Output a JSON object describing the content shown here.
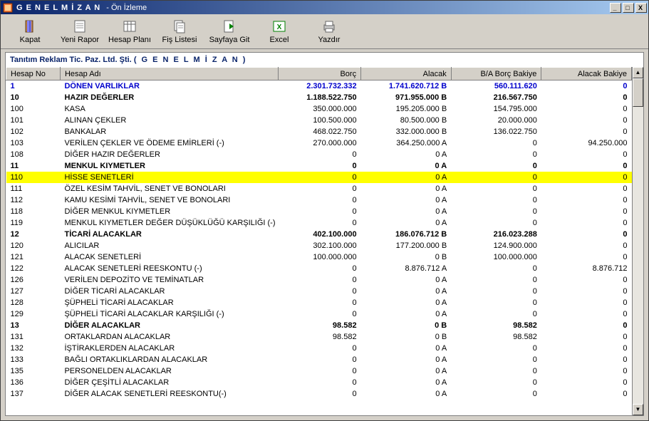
{
  "window": {
    "title_main": "G E N E L   M İ Z A N",
    "title_sub": "- Ön İzleme"
  },
  "toolbar": {
    "kapat": "Kapat",
    "yeni_rapor": "Yeni Rapor",
    "hesap_plani": "Hesap Planı",
    "fis_listesi": "Fiş Listesi",
    "sayfaya_git": "Sayfaya Git",
    "excel": "Excel",
    "yazdir": "Yazdır"
  },
  "header": {
    "company": "Tanıtım Reklam Tic. Paz. Ltd. Şti.",
    "report": "( G E N E L   M İ Z A N )"
  },
  "columns": {
    "hesap_no": "Hesap No",
    "hesap_adi": "Hesap Adı",
    "borc": "Borç",
    "alacak": "Alacak",
    "ba_borc_bakiye": "B/A Borç Bakiye",
    "alacak_bakiye": "Alacak Bakiye"
  },
  "rows": [
    {
      "no": "1",
      "ad": "DÖNEN VARLIKLAR",
      "borc": "2.301.732.332",
      "alacak": "1.741.620.712 B",
      "bakiye": "560.111.620",
      "alb": "0",
      "style": "blue"
    },
    {
      "no": "10",
      "ad": "HAZIR DEĞERLER",
      "borc": "1.188.522.750",
      "alacak": "971.955.000 B",
      "bakiye": "216.567.750",
      "alb": "0",
      "style": "bold"
    },
    {
      "no": "100",
      "ad": "KASA",
      "borc": "350.000.000",
      "alacak": "195.205.000 B",
      "bakiye": "154.795.000",
      "alb": "0",
      "style": ""
    },
    {
      "no": "101",
      "ad": "ALINAN ÇEKLER",
      "borc": "100.500.000",
      "alacak": "80.500.000 B",
      "bakiye": "20.000.000",
      "alb": "0",
      "style": ""
    },
    {
      "no": "102",
      "ad": "BANKALAR",
      "borc": "468.022.750",
      "alacak": "332.000.000 B",
      "bakiye": "136.022.750",
      "alb": "0",
      "style": ""
    },
    {
      "no": "103",
      "ad": "VERİLEN ÇEKLER VE ÖDEME EMİRLERİ (-)",
      "borc": "270.000.000",
      "alacak": "364.250.000 A",
      "bakiye": "0",
      "alb": "94.250.000",
      "style": ""
    },
    {
      "no": "108",
      "ad": "DİĞER HAZIR DEĞERLER",
      "borc": "0",
      "alacak": "0 A",
      "bakiye": "0",
      "alb": "0",
      "style": ""
    },
    {
      "no": "11",
      "ad": "MENKUL KIYMETLER",
      "borc": "0",
      "alacak": "0 A",
      "bakiye": "0",
      "alb": "0",
      "style": "bold"
    },
    {
      "no": "110",
      "ad": "HİSSE SENETLERİ",
      "borc": "0",
      "alacak": "0 A",
      "bakiye": "0",
      "alb": "0",
      "style": "sel"
    },
    {
      "no": "111",
      "ad": "ÖZEL KESİM TAHVİL, SENET VE BONOLARI",
      "borc": "0",
      "alacak": "0 A",
      "bakiye": "0",
      "alb": "0",
      "style": ""
    },
    {
      "no": "112",
      "ad": "KAMU KESİMİ TAHVİL, SENET VE BONOLARI",
      "borc": "0",
      "alacak": "0 A",
      "bakiye": "0",
      "alb": "0",
      "style": ""
    },
    {
      "no": "118",
      "ad": "DİĞER MENKUL KIYMETLER",
      "borc": "0",
      "alacak": "0 A",
      "bakiye": "0",
      "alb": "0",
      "style": ""
    },
    {
      "no": "119",
      "ad": "MENKUL KIYMETLER DEĞER DÜŞÜKLÜĞÜ KARŞILIĞI (-)",
      "borc": "0",
      "alacak": "0 A",
      "bakiye": "0",
      "alb": "0",
      "style": ""
    },
    {
      "no": "12",
      "ad": "TİCARİ ALACAKLAR",
      "borc": "402.100.000",
      "alacak": "186.076.712 B",
      "bakiye": "216.023.288",
      "alb": "0",
      "style": "bold"
    },
    {
      "no": "120",
      "ad": "ALICILAR",
      "borc": "302.100.000",
      "alacak": "177.200.000 B",
      "bakiye": "124.900.000",
      "alb": "0",
      "style": ""
    },
    {
      "no": "121",
      "ad": "ALACAK SENETLERİ",
      "borc": "100.000.000",
      "alacak": "0 B",
      "bakiye": "100.000.000",
      "alb": "0",
      "style": ""
    },
    {
      "no": "122",
      "ad": "ALACAK SENETLERİ REESKONTU (-)",
      "borc": "0",
      "alacak": "8.876.712 A",
      "bakiye": "0",
      "alb": "8.876.712",
      "style": ""
    },
    {
      "no": "126",
      "ad": "VERİLEN DEPOZİTO VE TEMİNATLAR",
      "borc": "0",
      "alacak": "0 A",
      "bakiye": "0",
      "alb": "0",
      "style": ""
    },
    {
      "no": "127",
      "ad": "DİĞER TİCARİ ALACAKLAR",
      "borc": "0",
      "alacak": "0 A",
      "bakiye": "0",
      "alb": "0",
      "style": ""
    },
    {
      "no": "128",
      "ad": "ŞÜPHELİ TİCARİ ALACAKLAR",
      "borc": "0",
      "alacak": "0 A",
      "bakiye": "0",
      "alb": "0",
      "style": ""
    },
    {
      "no": "129",
      "ad": "ŞÜPHELİ TİCARİ ALACAKLAR KARŞILIĞI (-)",
      "borc": "0",
      "alacak": "0 A",
      "bakiye": "0",
      "alb": "0",
      "style": ""
    },
    {
      "no": "13",
      "ad": "DİĞER ALACAKLAR",
      "borc": "98.582",
      "alacak": "0 B",
      "bakiye": "98.582",
      "alb": "0",
      "style": "bold"
    },
    {
      "no": "131",
      "ad": "ORTAKLARDAN ALACAKLAR",
      "borc": "98.582",
      "alacak": "0 B",
      "bakiye": "98.582",
      "alb": "0",
      "style": ""
    },
    {
      "no": "132",
      "ad": "İŞTİRAKLERDEN ALACAKLAR",
      "borc": "0",
      "alacak": "0 A",
      "bakiye": "0",
      "alb": "0",
      "style": ""
    },
    {
      "no": "133",
      "ad": "BAĞLI ORTAKLIKLARDAN ALACAKLAR",
      "borc": "0",
      "alacak": "0 A",
      "bakiye": "0",
      "alb": "0",
      "style": ""
    },
    {
      "no": "135",
      "ad": "PERSONELDEN ALACAKLAR",
      "borc": "0",
      "alacak": "0 A",
      "bakiye": "0",
      "alb": "0",
      "style": ""
    },
    {
      "no": "136",
      "ad": "DİĞER ÇEŞİTLİ ALACAKLAR",
      "borc": "0",
      "alacak": "0 A",
      "bakiye": "0",
      "alb": "0",
      "style": ""
    },
    {
      "no": "137",
      "ad": "DİĞER ALACAK SENETLERİ REESKONTU(-)",
      "borc": "0",
      "alacak": "0 A",
      "bakiye": "0",
      "alb": "0",
      "style": ""
    }
  ]
}
